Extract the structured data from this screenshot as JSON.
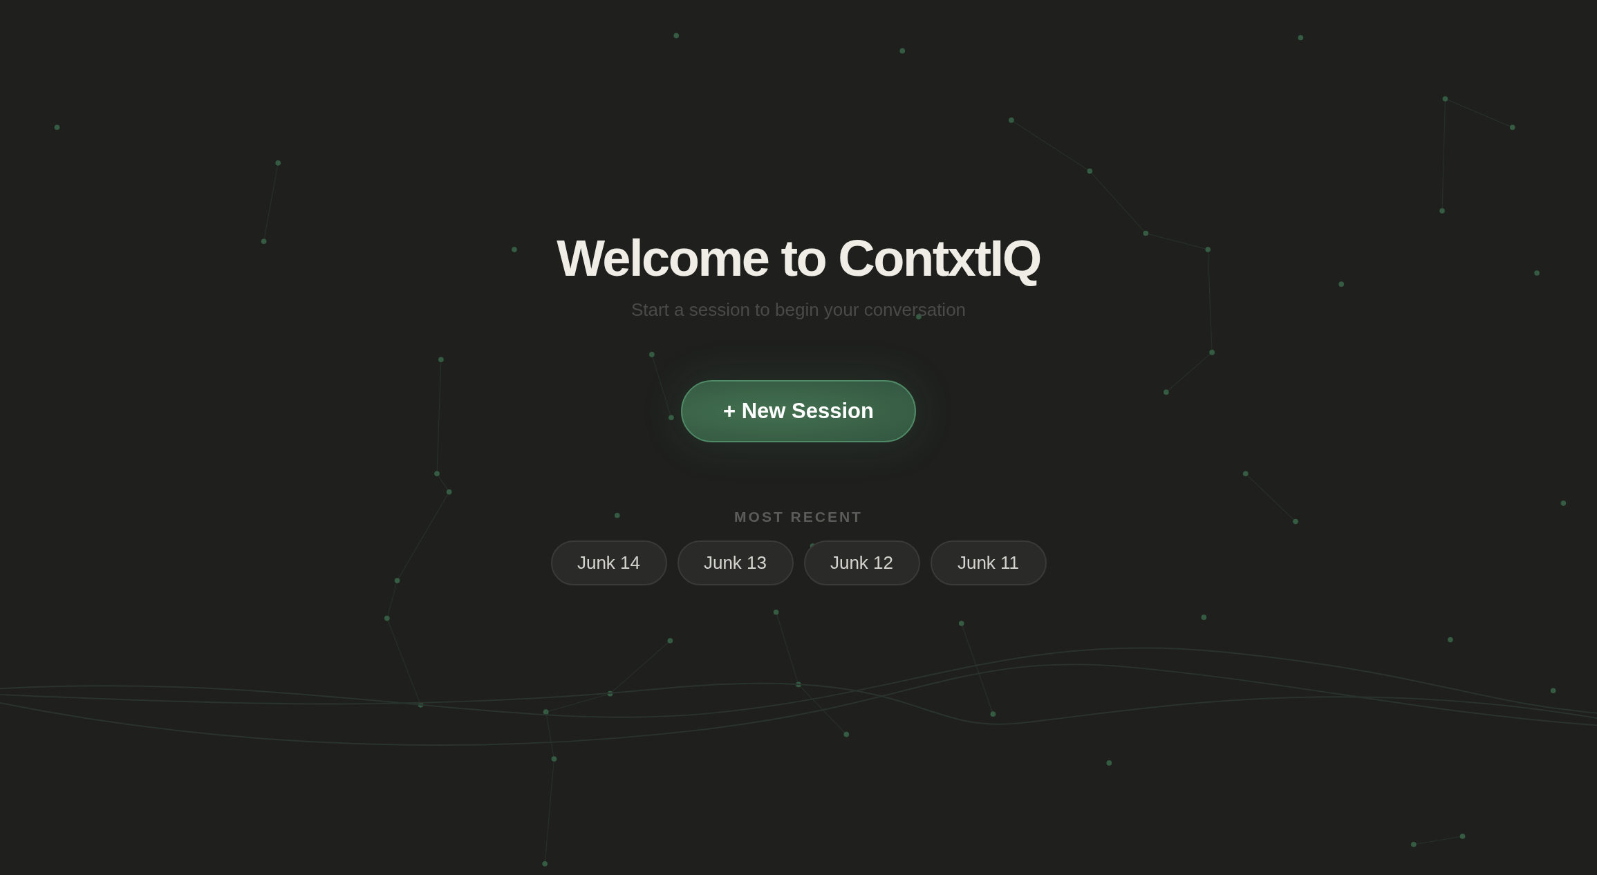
{
  "title": "Welcome to ContxtIQ",
  "subtitle": "Start a session to begin your conversation",
  "new_session_button": {
    "label": "+ New Session"
  },
  "recent": {
    "heading": "MOST RECENT",
    "sessions": [
      {
        "label": "Junk 14"
      },
      {
        "label": "Junk 13"
      },
      {
        "label": "Junk 12"
      },
      {
        "label": "Junk 11"
      }
    ]
  }
}
